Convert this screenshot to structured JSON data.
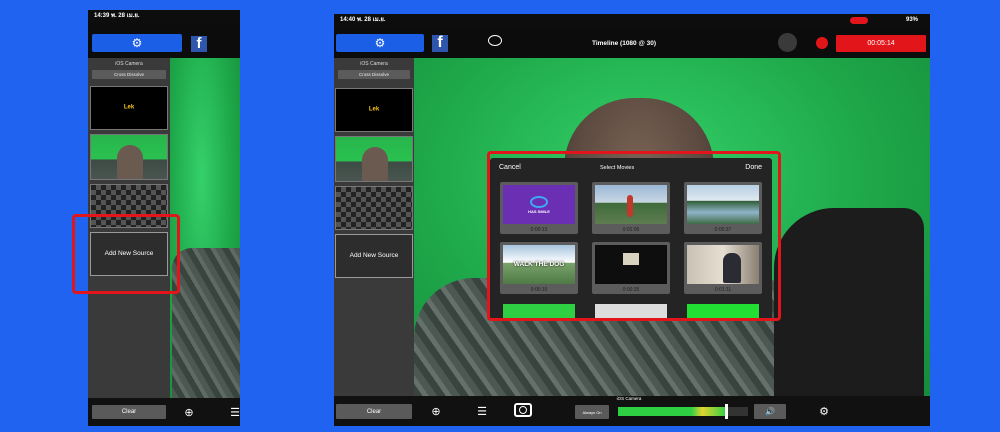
{
  "left": {
    "statusbar_time": "14:39 พ. 28 เม.ย.",
    "sidebar": {
      "source_title": "iOS Camera",
      "transition_label": "Cross Dissolve",
      "logo_text": "Lek",
      "add_new_source": "Add New Source"
    },
    "clear_label": "Clear"
  },
  "right": {
    "statusbar_time": "14:40 พ. 28 เม.ย.",
    "battery_text": "93%",
    "title": "Timeline (1080 @ 30)",
    "rec_time": "00:05:14",
    "sidebar": {
      "source_title": "iOS Camera",
      "transition_label": "Cross Dissolve",
      "logo_text": "Lek",
      "add_new_source": "Add New Source"
    },
    "modal": {
      "cancel": "Cancel",
      "title": "Select Movies",
      "done": "Done",
      "thumbs": [
        {
          "name": "hashtag-logo",
          "duration": "0:00:13",
          "caption": "HAS SMILE"
        },
        {
          "name": "running-park",
          "duration": "0:01:06",
          "caption": ""
        },
        {
          "name": "river-landscape",
          "duration": "0:00:37",
          "caption": ""
        },
        {
          "name": "walk-the-dog",
          "duration": "0:00:15",
          "caption": "WALK THE DOG"
        },
        {
          "name": "dark-room",
          "duration": "0:00:35",
          "caption": ""
        },
        {
          "name": "office-desk",
          "duration": "0:01:11",
          "caption": ""
        }
      ]
    },
    "bottom": {
      "clear_label": "Clear",
      "audio_source_label": "iOS Camera",
      "mute_label": "Always On",
      "volume_level": 0.83
    }
  },
  "colors": {
    "accent_blue": "#1b5fe6",
    "record_red": "#e2161a",
    "green_screen": "#1ea84a"
  }
}
